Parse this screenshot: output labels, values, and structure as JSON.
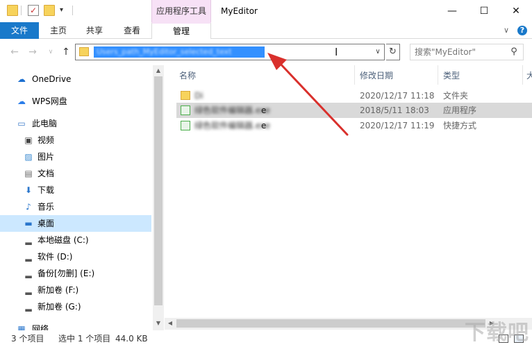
{
  "window": {
    "title": "MyEditor",
    "tool_tab": "应用程序工具",
    "minimize": "—",
    "maximize": "☐",
    "close": "✕"
  },
  "ribbon": {
    "tabs": [
      "文件",
      "主页",
      "共享",
      "查看",
      "管理"
    ],
    "expand_icon": "∨",
    "help_icon": "?"
  },
  "address": {
    "path_text": "Users_path_MyEditor_selected_text",
    "search_placeholder": "搜索\"MyEditor\""
  },
  "sidebar": {
    "items": [
      {
        "label": "OneDrive",
        "icon": "cloud-icon",
        "color": "#1b6fd0"
      },
      {
        "label": "WPS网盘",
        "icon": "cloud-icon",
        "color": "#2b7de9"
      },
      {
        "label": "此电脑",
        "icon": "computer-icon",
        "color": "#3a7ac8"
      },
      {
        "label": "视频",
        "icon": "video-icon",
        "color": "#444"
      },
      {
        "label": "图片",
        "icon": "picture-icon",
        "color": "#3a8ad0"
      },
      {
        "label": "文档",
        "icon": "document-icon",
        "color": "#666"
      },
      {
        "label": "下载",
        "icon": "download-icon",
        "color": "#2a76cc"
      },
      {
        "label": "音乐",
        "icon": "music-icon",
        "color": "#2a76cc"
      },
      {
        "label": "桌面",
        "icon": "desktop-icon",
        "color": "#2a76cc"
      },
      {
        "label": "本地磁盘 (C:)",
        "icon": "drive-icon",
        "color": "#555"
      },
      {
        "label": "软件 (D:)",
        "icon": "drive-icon",
        "color": "#555"
      },
      {
        "label": "备份[勿删] (E:)",
        "icon": "drive-icon",
        "color": "#555"
      },
      {
        "label": "新加卷 (F:)",
        "icon": "drive-icon",
        "color": "#555"
      },
      {
        "label": "新加卷 (G:)",
        "icon": "drive-icon",
        "color": "#555"
      },
      {
        "label": "网络",
        "icon": "network-icon",
        "color": "#2a76cc"
      }
    ]
  },
  "columns": [
    "名称",
    "修改日期",
    "类型",
    "大"
  ],
  "files": [
    {
      "name": "Di",
      "date": "2020/12/17 11:18",
      "type": "文件夹",
      "icon_color": "#f7d35c"
    },
    {
      "name": "绿色软件编辑器.exe",
      "suffix": "e",
      "date": "2018/5/11 18:03",
      "type": "应用程序",
      "icon_color": "#4cae4c"
    },
    {
      "name": "绿色软件编辑器.exe",
      "suffix": "e",
      "date": "2020/12/17 11:19",
      "type": "快捷方式",
      "icon_color": "#4cae4c"
    }
  ],
  "status": {
    "count": "3 个项目",
    "selection": "选中 1 个项目",
    "size": "44.0 KB"
  },
  "watermark": "下载吧",
  "colors": {
    "accent": "#1979ca",
    "selection": "#cce8ff",
    "arrow": "#d9302c"
  }
}
